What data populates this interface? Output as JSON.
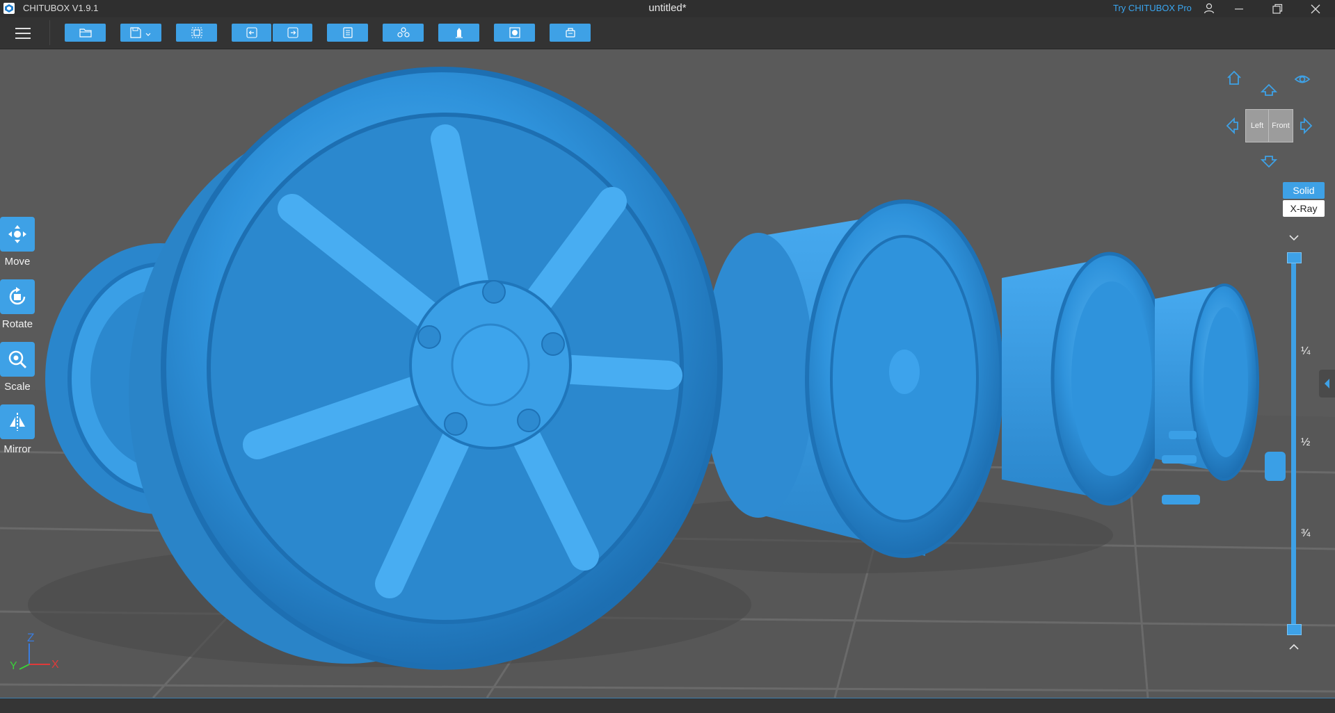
{
  "titlebar": {
    "app_name": "CHITUBOX V1.9.1",
    "document_title": "untitled*",
    "pro_link": "Try CHITUBOX Pro",
    "accent_color": "#3aa6f0"
  },
  "toolbar": {
    "buttons": [
      {
        "icon": "open-folder-icon"
      },
      {
        "icon": "save-icon",
        "has_dropdown": true
      },
      {
        "icon": "select-all-icon"
      },
      {
        "icon": "undo-icon"
      },
      {
        "icon": "redo-icon"
      },
      {
        "icon": "layout-icon"
      },
      {
        "icon": "supports-icon"
      },
      {
        "icon": "hollow-icon"
      },
      {
        "icon": "slice-icon"
      },
      {
        "icon": "print-icon"
      }
    ],
    "button_color": "#3ea1e6"
  },
  "left_tools": [
    {
      "label": "Move",
      "icon": "move-icon"
    },
    {
      "label": "Rotate",
      "icon": "rotate-icon"
    },
    {
      "label": "Scale",
      "icon": "scale-icon"
    },
    {
      "label": "Mirror",
      "icon": "mirror-icon"
    }
  ],
  "view_cube": {
    "left_face": "Left",
    "front_face": "Front"
  },
  "render_mode": {
    "solid": "Solid",
    "xray": "X-Ray",
    "selected": "Solid"
  },
  "layer_slider": {
    "ticks": [
      "¼",
      "½",
      "¾"
    ]
  },
  "axes": {
    "z": "Z",
    "y": "Y",
    "x": "X"
  },
  "colors": {
    "model": "#3a9fe6",
    "viewport_bg": "#5b5b5b",
    "titlebar_bg": "#2f2f2f"
  }
}
